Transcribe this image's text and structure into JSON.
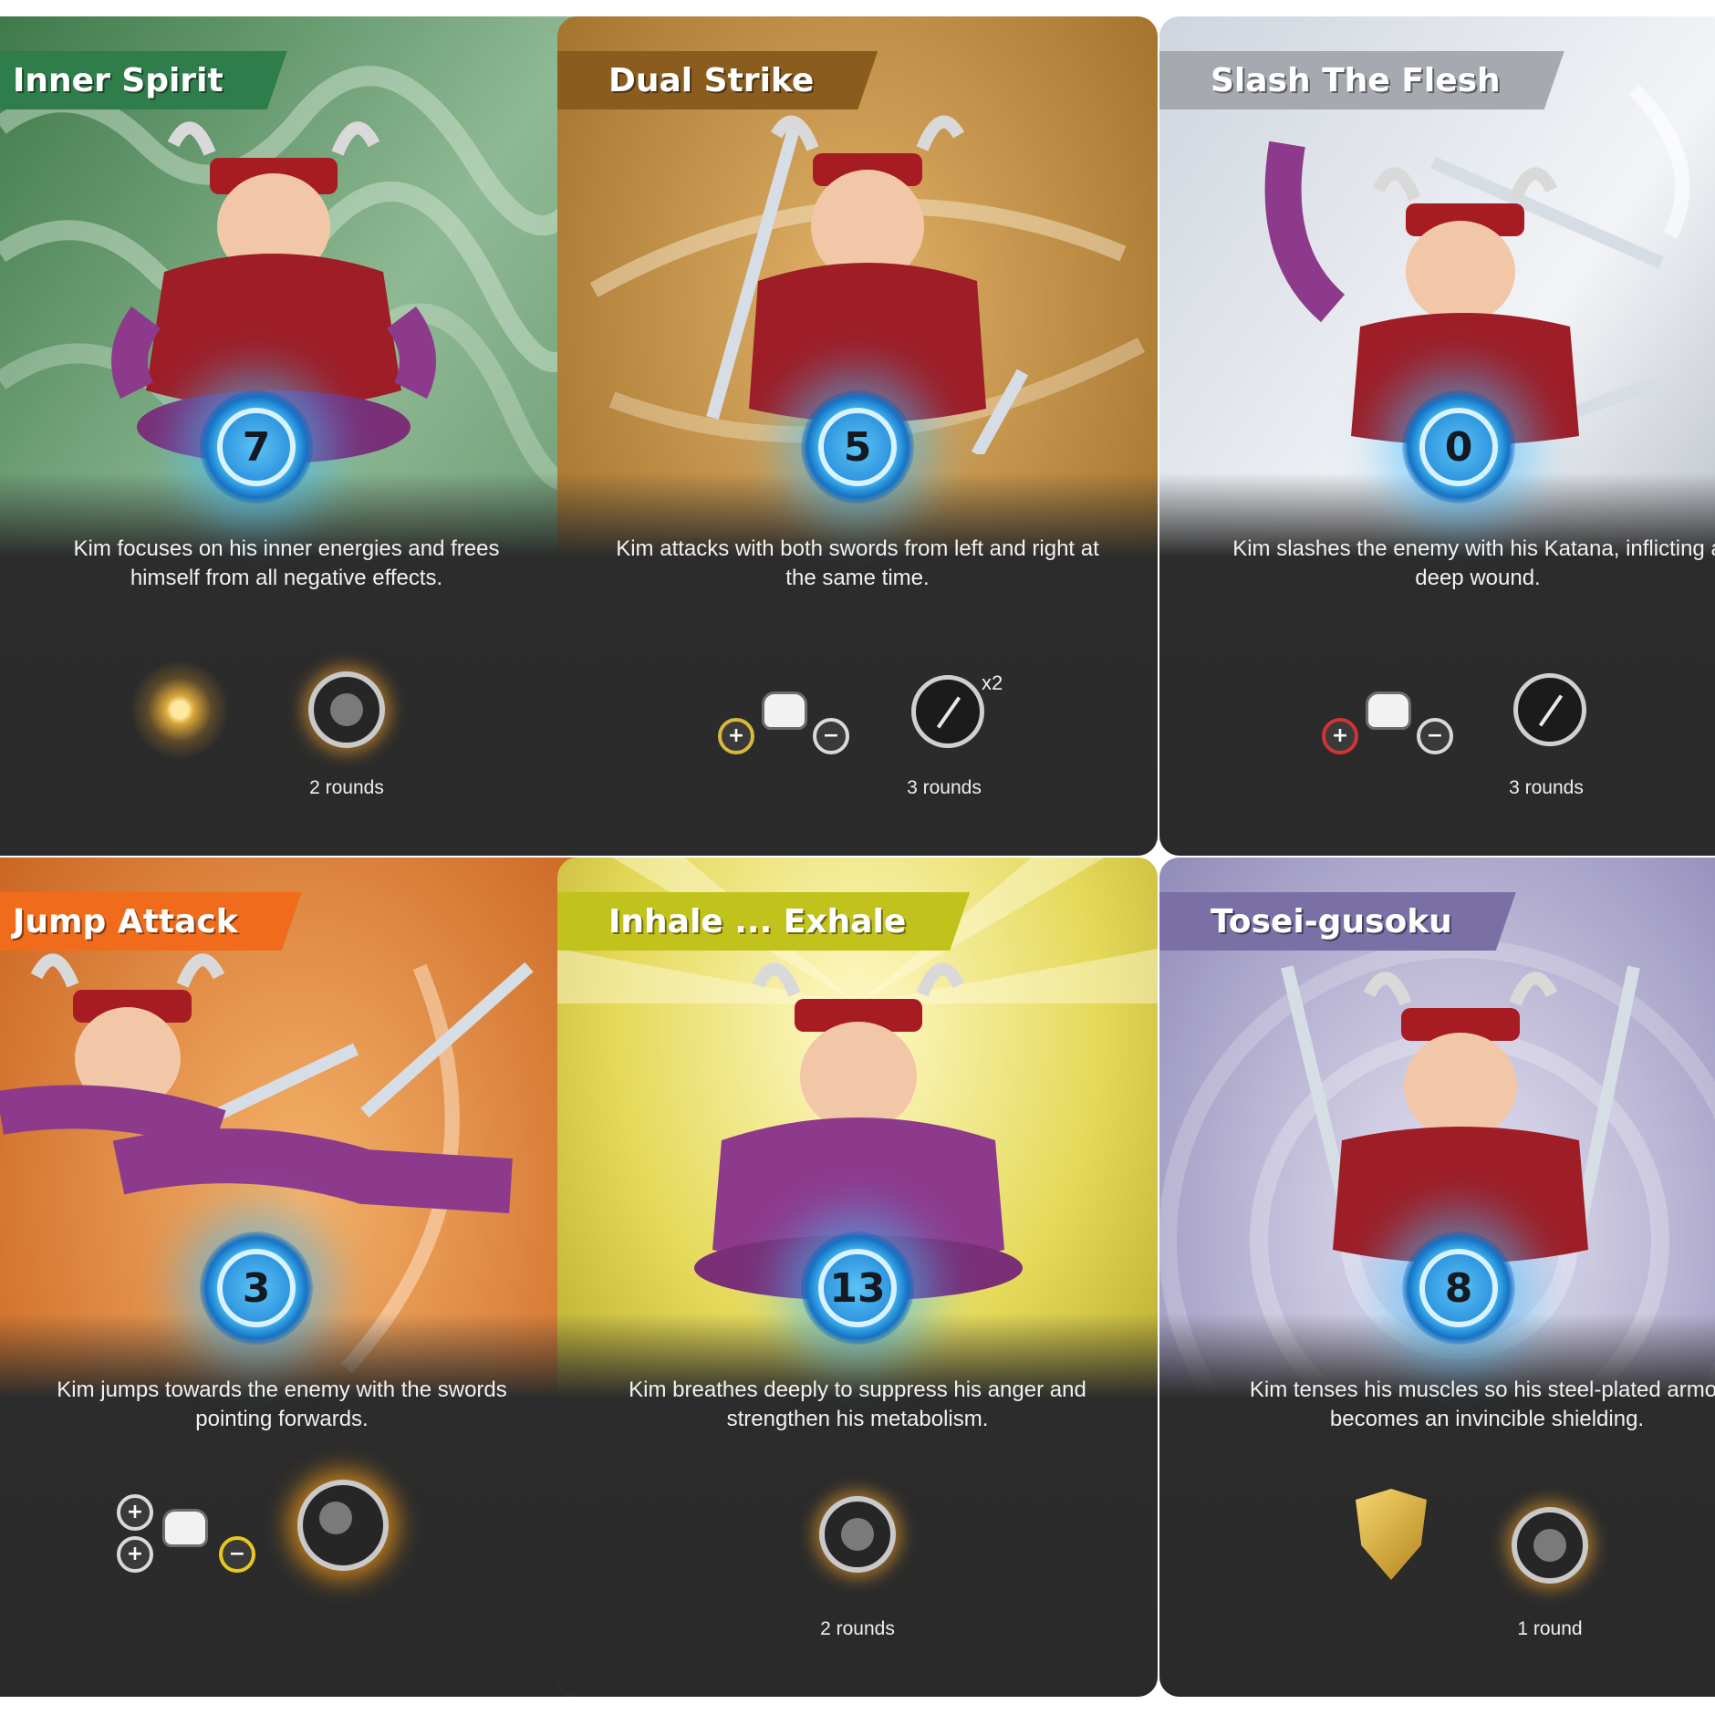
{
  "cards": [
    {
      "title": "Inner Spirit",
      "value": "7",
      "description": "Kim focuses on his inner energies and frees himself from all negative effects.",
      "duration": "2 rounds",
      "banner_color": "#2e7d4a",
      "bg_color": "#6f9d73"
    },
    {
      "title": "Dual Strike",
      "value": "5",
      "description": "Kim attacks with both swords from left and right at the same time.",
      "duration": "3 rounds",
      "multiplier": "x2",
      "banner_color": "#8a5d1f",
      "bg_color": "#b9822f"
    },
    {
      "title": "Slash The Flesh",
      "value": "0",
      "description": "Kim slashes the enemy with his Katana, inflicting a deep wound.",
      "duration": "3 rounds",
      "banner_color": "#a7a9b1",
      "bg_color": "#cfd4dc"
    },
    {
      "title": "Jump Attack",
      "value": "3",
      "description": "Kim jumps towards the enemy with the swords pointing forwards.",
      "banner_color": "#f06c1c",
      "bg_color": "#e1813c"
    },
    {
      "title": "Inhale ... Exhale",
      "value": "13",
      "description": "Kim breathes deeply to suppress his anger and strengthen his metabolism.",
      "duration": "2 rounds",
      "banner_color": "#c2c21d",
      "bg_color": "#dcd14a"
    },
    {
      "title": "Tosei-gusoku",
      "value": "8",
      "description": "Kim tenses his muscles so his steel-plated armor becomes an invincible shielding.",
      "duration": "1 round",
      "banner_color": "#7a70a6",
      "bg_color": "#9d98c2"
    }
  ],
  "icons": {
    "character": "samurai-icon",
    "energy": "energy-orb-icon",
    "timer": "round-timer-icon",
    "sword": "crossed-swords-icon",
    "fist": "fist-icon",
    "plus": "+",
    "minus": "−",
    "shield": "shield-icon",
    "aura": "aura-icon"
  }
}
